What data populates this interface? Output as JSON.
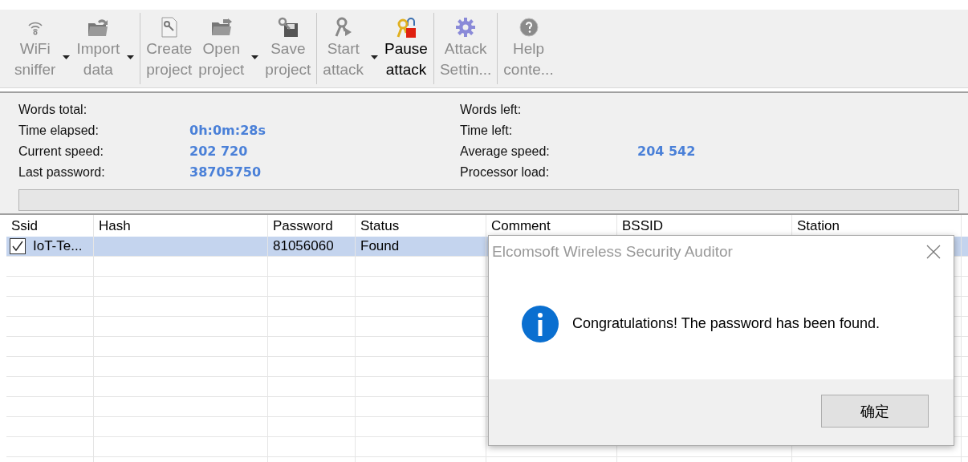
{
  "toolbar": [
    {
      "kind": "button",
      "line1": "WiFi",
      "line2": "sniffer",
      "disabled": true,
      "dropdown": true
    },
    {
      "kind": "button",
      "line1": "Import",
      "line2": "data",
      "disabled": true,
      "dropdown": true
    },
    {
      "kind": "separator"
    },
    {
      "kind": "button",
      "line1": "Create",
      "line2": "project",
      "disabled": true,
      "dropdown": false
    },
    {
      "kind": "button",
      "line1": "Open",
      "line2": "project",
      "disabled": true,
      "dropdown": true
    },
    {
      "kind": "button",
      "line1": "Save",
      "line2": "project",
      "disabled": true,
      "dropdown": false
    },
    {
      "kind": "separator"
    },
    {
      "kind": "button",
      "line1": "Start",
      "line2": "attack",
      "disabled": true,
      "dropdown": true
    },
    {
      "kind": "button",
      "line1": "Pause",
      "line2": "attack",
      "disabled": false,
      "dropdown": false
    },
    {
      "kind": "separator"
    },
    {
      "kind": "button",
      "line1": "Attack",
      "line2": "Settin...",
      "disabled": true,
      "dropdown": false
    },
    {
      "kind": "separator"
    },
    {
      "kind": "button",
      "line1": "Help",
      "line2": "conte...",
      "disabled": true,
      "dropdown": false
    }
  ],
  "stats": {
    "left": [
      {
        "label": "Words total:"
      },
      {
        "label": "Time elapsed:",
        "value": "0h:0m:28s"
      },
      {
        "label": "Current speed:",
        "value": "202 720"
      },
      {
        "label": "Last password:",
        "value": "38705750"
      }
    ],
    "right": [
      {
        "label": "Words left:"
      },
      {
        "label": "Time left:"
      },
      {
        "label": "Average speed:",
        "value": "204 542"
      },
      {
        "label": "Processor load:"
      }
    ],
    "progress_bar": true
  },
  "table": {
    "columns": [
      "Ssid",
      "Hash",
      "Password",
      "Status",
      "Comment",
      "BSSID",
      "Station"
    ],
    "rows": [
      {
        "checked": true,
        "selected": true,
        "cells": [
          "IoT-Te...",
          "",
          "81056060",
          "Found"
        ]
      }
    ]
  },
  "dialog": {
    "title": "Elcomsoft Wireless Security Auditor",
    "message": "Congratulations! The password has been found.",
    "button": "确定"
  }
}
